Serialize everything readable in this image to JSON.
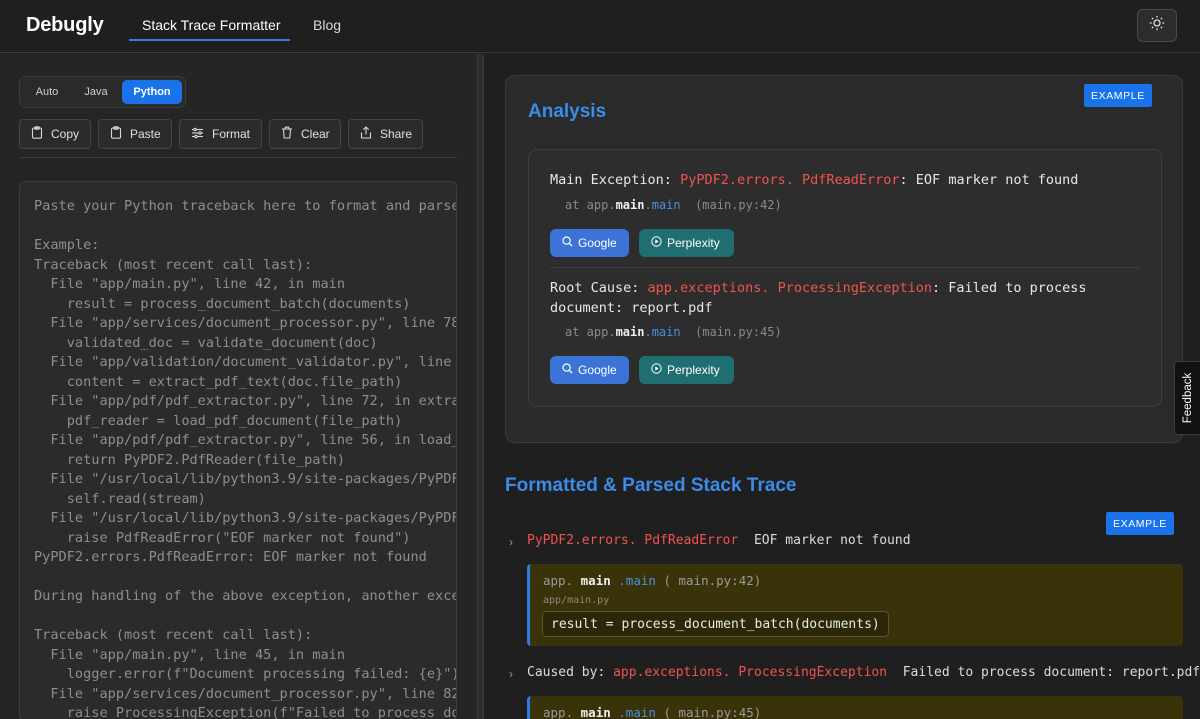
{
  "header": {
    "logo": "Debugly",
    "tabs": [
      {
        "label": "Stack Trace Formatter",
        "active": true
      },
      {
        "label": "Blog",
        "active": false
      }
    ],
    "theme_toggle_icon": "sun-icon"
  },
  "left": {
    "languages": [
      {
        "label": "Auto",
        "selected": false
      },
      {
        "label": "Java",
        "selected": false
      },
      {
        "label": "Python",
        "selected": true
      }
    ],
    "toolbar": [
      {
        "label": "Copy",
        "icon": "clipboard-icon"
      },
      {
        "label": "Paste",
        "icon": "clipboard-icon"
      },
      {
        "label": "Format",
        "icon": "sliders-icon"
      },
      {
        "label": "Clear",
        "icon": "trash-icon"
      },
      {
        "label": "Share",
        "icon": "share-icon"
      }
    ],
    "editor_placeholder": "Paste your Python traceback here to format and parse...\n\nExample:\nTraceback (most recent call last):\n  File \"app/main.py\", line 42, in main\n    result = process_document_batch(documents)\n  File \"app/services/document_processor.py\", line 78, in process_document_batch\n    validated_doc = validate_document(doc)\n  File \"app/validation/document_validator.py\", line 115, in validate_document\n    content = extract_pdf_text(doc.file_path)\n  File \"app/pdf/pdf_extractor.py\", line 72, in extract_pdf_text\n    pdf_reader = load_pdf_document(file_path)\n  File \"app/pdf/pdf_extractor.py\", line 56, in load_pdf_document\n    return PyPDF2.PdfReader(file_path)\n  File \"/usr/local/lib/python3.9/site-packages/PyPDF2/_reader.py\"\n    self.read(stream)\n  File \"/usr/local/lib/python3.9/site-packages/PyPDF2/_reader.py\"\n    raise PdfReadError(\"EOF marker not found\")\nPyPDF2.errors.PdfReadError: EOF marker not found\n\nDuring handling of the above exception, another exception occurred:\n\nTraceback (most recent call last):\n  File \"app/main.py\", line 45, in main\n    logger.error(f\"Document processing failed: {e}\")\n  File \"app/services/document_processor.py\", line 82, in process_document_batch\n    raise ProcessingException(f\"Failed to process document: {doc.name}\")"
  },
  "analysis": {
    "title": "Analysis",
    "badge": "EXAMPLE",
    "main": {
      "label": "Main Exception:",
      "package": "PyPDF2.errors.",
      "class": "PdfReadError",
      "message": ": EOF marker not found",
      "at_prefix": "at app.",
      "at_bold": "main",
      "at_method": ".main",
      "location": "(main.py:42)"
    },
    "root": {
      "label": "Root Cause:",
      "package": "app.exceptions.",
      "class": "ProcessingException",
      "message_1": ": Failed to process",
      "message_2": "document: report.pdf",
      "at_prefix": "at app.",
      "at_bold": "main",
      "at_method": ".main",
      "location": "(main.py:45)"
    },
    "google_label": "Google",
    "perplexity_label": "Perplexity"
  },
  "formatted": {
    "title": "Formatted & Parsed Stack Trace",
    "badge": "EXAMPLE",
    "exception_1": {
      "package": "PyPDF2.errors.",
      "class": "PdfReadError",
      "message": "EOF marker not found"
    },
    "frame_1": {
      "prefix": "app.",
      "bold": "main",
      "method": ".main",
      "location": "( main.py:42)",
      "file": "app/main.py",
      "code": "result = process_document_batch(documents)"
    },
    "exception_2": {
      "caused_by": "Caused by:",
      "package": "app.exceptions.",
      "class": "ProcessingException",
      "message": "Failed to process document: report.pdf"
    },
    "frame_2": {
      "prefix": "app.",
      "bold": "main",
      "method": ".main",
      "location": "( main.py:45)"
    }
  },
  "feedback_label": "Feedback",
  "colors": {
    "accent": "#1a73e8",
    "error": "#ef5350",
    "frame_bg": "#3a3209"
  }
}
